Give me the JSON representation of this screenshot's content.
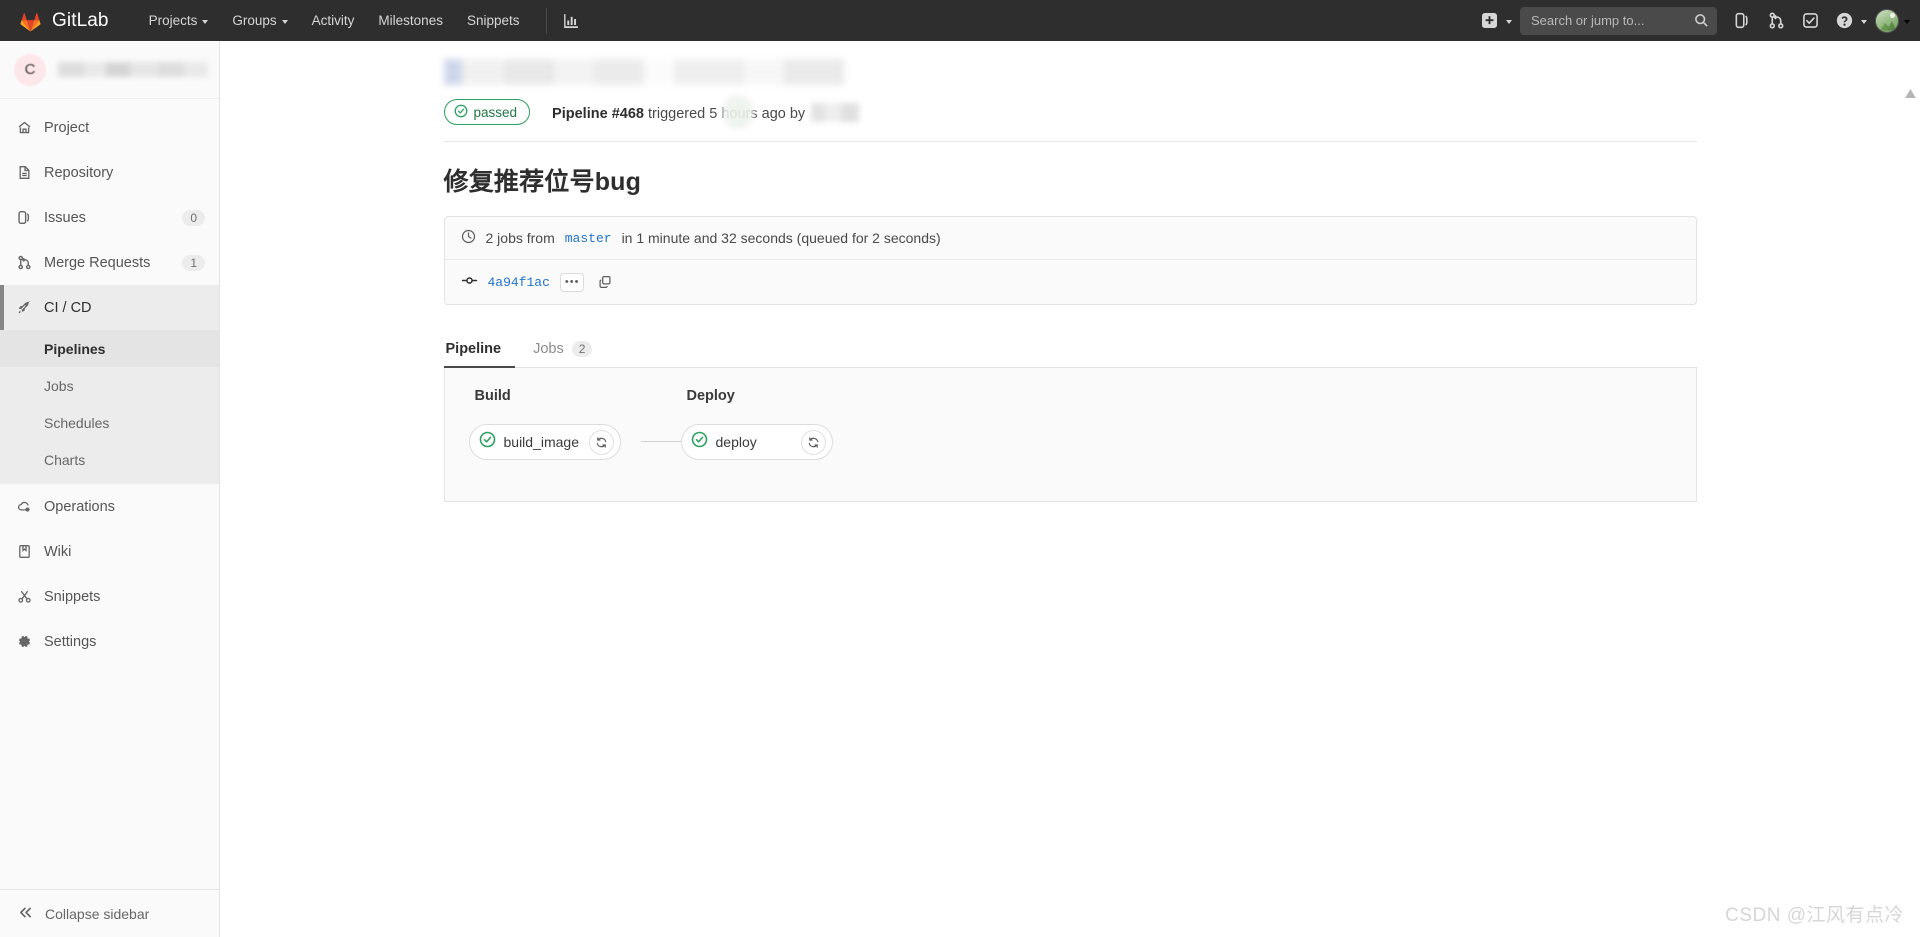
{
  "topnav": {
    "brand": "GitLab",
    "brand_icon": "gitlab-logo-icon",
    "links": [
      {
        "label": "Projects",
        "has_caret": true
      },
      {
        "label": "Groups",
        "has_caret": true
      },
      {
        "label": "Activity",
        "has_caret": false
      },
      {
        "label": "Milestones",
        "has_caret": false
      },
      {
        "label": "Snippets",
        "has_caret": false
      }
    ],
    "analytics_icon": "chart-bar-icon",
    "plus_icon": "plus-square-icon",
    "search": {
      "placeholder": "Search or jump to...",
      "value": "",
      "icon": "search-icon"
    },
    "icons": [
      {
        "name": "issues-icon",
        "title": "Issues"
      },
      {
        "name": "merge-requests-icon",
        "title": "Merge requests"
      },
      {
        "name": "todos-icon",
        "title": "To-Do list"
      },
      {
        "name": "help-icon",
        "title": "Help"
      }
    ],
    "avatar_icon": "user-avatar"
  },
  "sidebar": {
    "project_initial": "C",
    "project_name_redacted": true,
    "items": [
      {
        "label": "Project",
        "icon": "home-icon",
        "badge": null,
        "active": false
      },
      {
        "label": "Repository",
        "icon": "document-icon",
        "badge": null,
        "active": false
      },
      {
        "label": "Issues",
        "icon": "issues-icon",
        "badge": "0",
        "active": false
      },
      {
        "label": "Merge Requests",
        "icon": "merge-requests-icon",
        "badge": "1",
        "active": false
      },
      {
        "label": "CI / CD",
        "icon": "rocket-icon",
        "badge": null,
        "active": true
      },
      {
        "label": "Operations",
        "icon": "cloud-gear-icon",
        "badge": null,
        "active": false
      },
      {
        "label": "Wiki",
        "icon": "book-icon",
        "badge": null,
        "active": false
      },
      {
        "label": "Snippets",
        "icon": "scissors-icon",
        "badge": null,
        "active": false
      },
      {
        "label": "Settings",
        "icon": "gear-icon",
        "badge": null,
        "active": false
      }
    ],
    "cicd_subitems": [
      {
        "label": "Pipelines",
        "active": true
      },
      {
        "label": "Jobs",
        "active": false
      },
      {
        "label": "Schedules",
        "active": false
      },
      {
        "label": "Charts",
        "active": false
      }
    ],
    "collapse": {
      "label": "Collapse sidebar",
      "icon": "double-chevron-left-icon"
    }
  },
  "pipeline": {
    "status": {
      "label": "passed",
      "icon": "status-success-icon",
      "color": "#2da160"
    },
    "header_prefix": "Pipeline",
    "header_number": "#468",
    "header_suffix": "triggered 5 hours ago by",
    "title": "修复推荐位号bug",
    "summary": {
      "icon": "clock-icon",
      "jobs_count_text": "2 jobs from",
      "branch": "master",
      "duration_text": "in 1 minute and 32 seconds (queued for 2 seconds)"
    },
    "commit": {
      "icon": "commit-node-icon",
      "sha": "4a94f1ac",
      "ellipsis_label": "•••",
      "copy_icon": "copy-icon"
    },
    "tabs": [
      {
        "label": "Pipeline",
        "badge": null,
        "active": true
      },
      {
        "label": "Jobs",
        "badge": "2",
        "active": false
      }
    ],
    "graph": {
      "stages": [
        {
          "name": "Build",
          "jobs": [
            {
              "name": "build_image",
              "status_icon": "status-success-icon",
              "retry_icon": "retry-icon"
            }
          ]
        },
        {
          "name": "Deploy",
          "jobs": [
            {
              "name": "deploy",
              "status_icon": "status-success-icon",
              "retry_icon": "retry-icon"
            }
          ]
        }
      ]
    }
  },
  "watermark": "CSDN @江风有点冷"
}
